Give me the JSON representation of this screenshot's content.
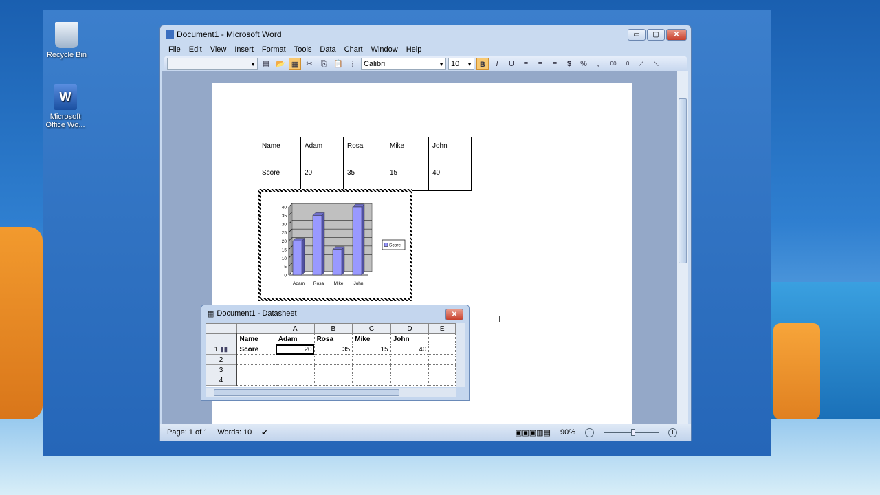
{
  "desktop": {
    "icons": [
      {
        "label": "Recycle Bin",
        "icon": "recycle-bin-icon"
      },
      {
        "label": "Microsoft Office Wo...",
        "icon": "word-document-icon"
      }
    ]
  },
  "window": {
    "title": "Document1 - Microsoft Word",
    "minimize": "▭",
    "maximize": "▢",
    "close": "✕"
  },
  "menu": [
    "File",
    "Edit",
    "View",
    "Insert",
    "Format",
    "Tools",
    "Data",
    "Chart",
    "Window",
    "Help"
  ],
  "toolbar": {
    "chart_object_combo": "",
    "font": "Calibri",
    "size": "10",
    "bold": "B",
    "italic": "I",
    "underline": "U",
    "currency": "$",
    "percent": "%",
    "comma": ",",
    "increase_decimal": ".00",
    "decrease_decimal": ".0"
  },
  "word_table": {
    "rows": [
      [
        "Name",
        "Adam",
        "Rosa",
        "Mike",
        "John"
      ],
      [
        "Score",
        "20",
        "35",
        "15",
        "40"
      ]
    ]
  },
  "chart_data": {
    "type": "bar",
    "categories": [
      "Adam",
      "Rosa",
      "Mike",
      "John"
    ],
    "series": [
      {
        "name": "Score",
        "values": [
          20,
          35,
          15,
          40
        ],
        "color": "#9999ff"
      }
    ],
    "ylim": [
      0,
      40
    ],
    "yticks": [
      "0",
      "5",
      "10",
      "15",
      "20",
      "25",
      "30",
      "35",
      "40"
    ],
    "grid": true,
    "legend": "right",
    "style": "3d-column"
  },
  "datasheet": {
    "title": "Document1 - Datasheet",
    "columns": [
      "",
      "A",
      "B",
      "C",
      "D",
      "E"
    ],
    "header_row": [
      "Name",
      "Adam",
      "Rosa",
      "Mike",
      "John",
      ""
    ],
    "rows": [
      {
        "num": "1",
        "label": "Score",
        "values": [
          "20",
          "35",
          "15",
          "40",
          ""
        ]
      },
      {
        "num": "2",
        "label": "",
        "values": [
          "",
          "",
          "",
          "",
          ""
        ]
      },
      {
        "num": "3",
        "label": "",
        "values": [
          "",
          "",
          "",
          "",
          ""
        ]
      },
      {
        "num": "4",
        "label": "",
        "values": [
          "",
          "",
          "",
          "",
          ""
        ]
      }
    ]
  },
  "status": {
    "page": "Page: 1 of 1",
    "words": "Words: 10",
    "zoom": "90%",
    "zoom_out": "−",
    "zoom_in": "+"
  }
}
